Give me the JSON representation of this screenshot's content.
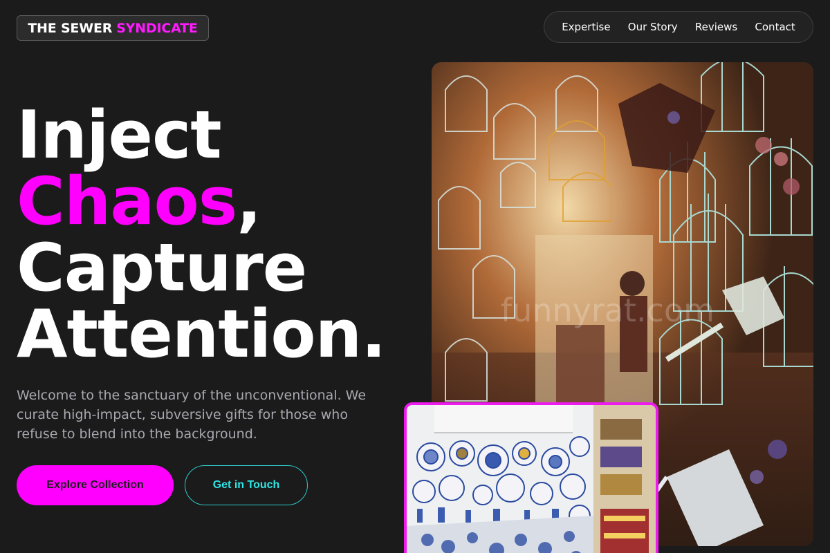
{
  "brand": {
    "name_part1": "THE SEWER",
    "name_part2": "SYNDICATE",
    "accent_color": "#ff00ff",
    "secondary_color": "#2ee6e6"
  },
  "nav": {
    "items": [
      {
        "label": "Expertise"
      },
      {
        "label": "Our Story"
      },
      {
        "label": "Reviews"
      },
      {
        "label": "Contact"
      }
    ]
  },
  "hero": {
    "line1": "Inject",
    "line2_accent": "Chaos",
    "line2_rest": ",",
    "line3": "Capture",
    "line4": "Attention.",
    "subtitle": "Welcome to the sanctuary of the unconventional. We curate high-impact, subversive gifts for those who refuse to blend into the background.",
    "primary_cta": "Explore Collection",
    "secondary_cta": "Get in Touch"
  },
  "images": {
    "main_watermark": "funnyrat.com"
  }
}
